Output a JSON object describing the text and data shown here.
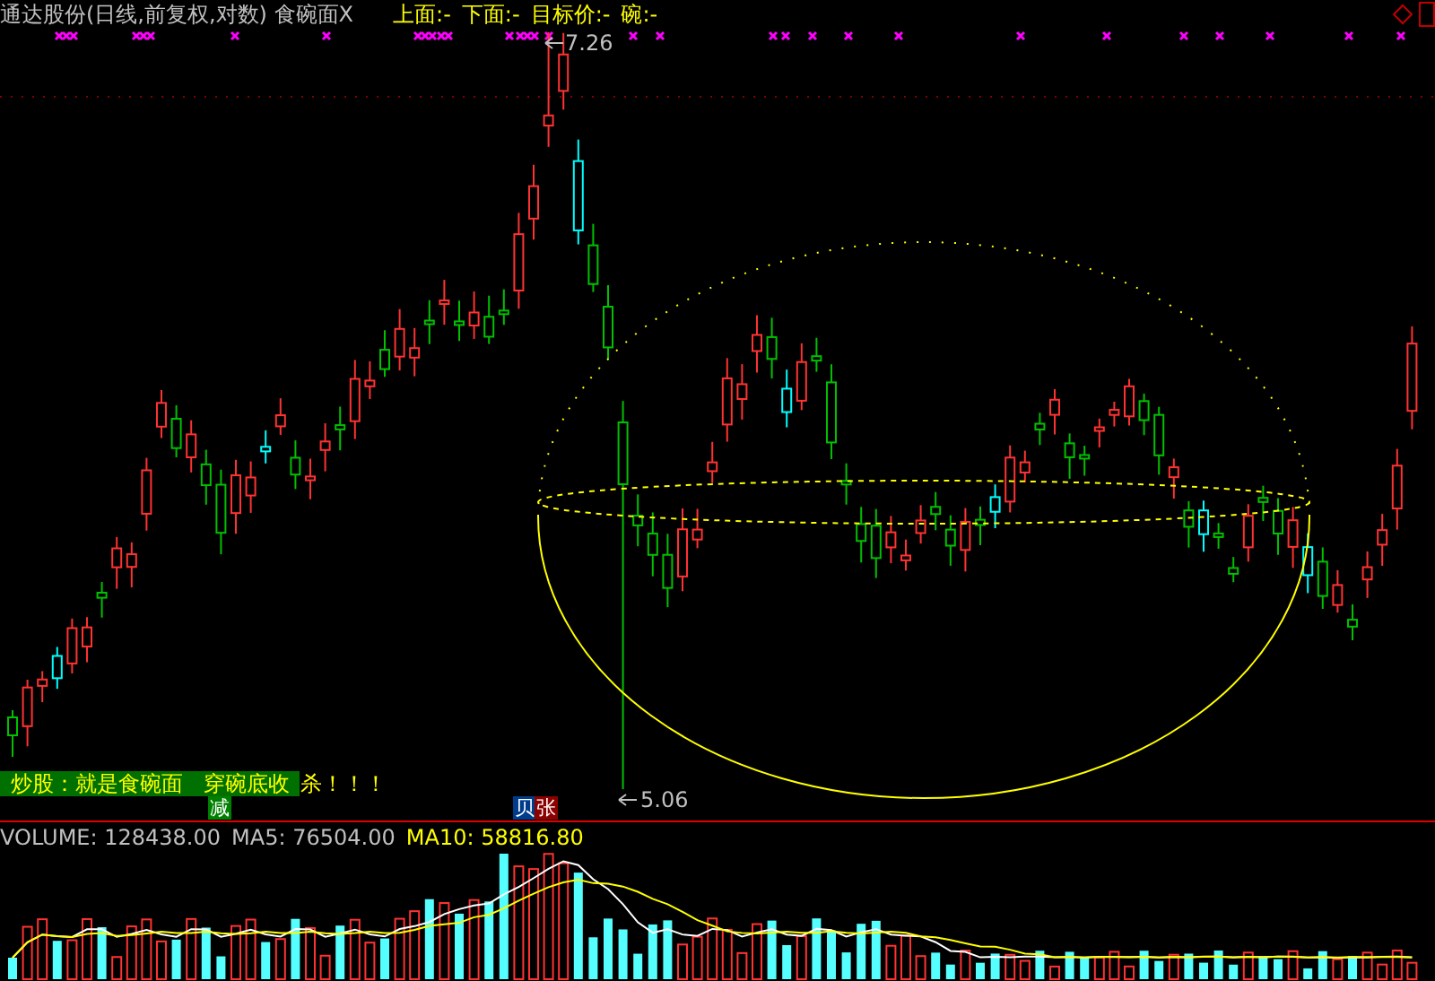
{
  "title": "通达股份(日线,前复权,对数) 食碗面X",
  "indicators": [
    {
      "label": "上面:",
      "value": "-"
    },
    {
      "label": "下面:",
      "value": "-"
    },
    {
      "label": "目标价:",
      "value": "-"
    },
    {
      "label": "碗:",
      "value": "-"
    }
  ],
  "price_chart": {
    "high_label": "7.26",
    "low_label": "5.06",
    "banner": {
      "highlighted": "炒股：就是食碗面   穿碗底收",
      "rest": "杀！！！"
    },
    "tags": [
      {
        "text": "减",
        "color": "#008000"
      },
      {
        "text": "贝",
        "color": "#003c8c"
      },
      {
        "text": "张",
        "color": "#8c0000"
      }
    ]
  },
  "volume": {
    "readings": [
      {
        "label": "VOLUME:",
        "value": "128438.00",
        "color": "#c0c0c0"
      },
      {
        "label": "MA5:",
        "value": "76504.00",
        "color": "#c0c0c0"
      },
      {
        "label": "MA10:",
        "value": "58816.80",
        "color": "#ffff00"
      }
    ]
  }
}
